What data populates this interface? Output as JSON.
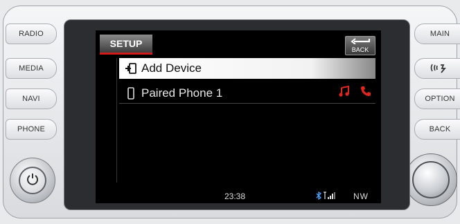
{
  "left_buttons": [
    {
      "label": "RADIO"
    },
    {
      "label": "MEDIA"
    },
    {
      "label": "NAVI"
    },
    {
      "label": "PHONE"
    }
  ],
  "right_buttons": [
    {
      "label": "MAIN"
    },
    {
      "label": ""
    },
    {
      "label": "OPTION"
    },
    {
      "label": "BACK"
    }
  ],
  "screen": {
    "title": "SETUP",
    "back_label": "BACK",
    "items": [
      {
        "label": "Add Device",
        "icon": "add-device-icon",
        "selected": true
      },
      {
        "label": "Paired Phone 1",
        "icon": "phone-icon",
        "selected": false
      }
    ],
    "status": {
      "time": "23:38",
      "heading": "NW"
    }
  },
  "colors": {
    "accent": "#d11a1a",
    "screen_bg": "#000000",
    "bezel": "#e9eaec"
  }
}
